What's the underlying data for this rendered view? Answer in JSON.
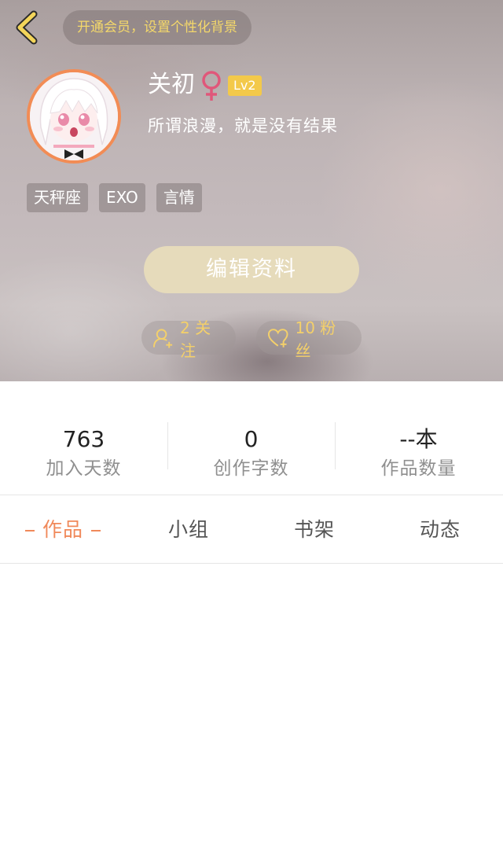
{
  "header": {
    "vip_banner": "开通会员，设置个性化背景",
    "username": "关初",
    "level": "Lv2",
    "signature": "所谓浪漫，就是没有结果",
    "tags": [
      "天秤座",
      "EXO",
      "言情"
    ],
    "edit_button": "编辑资料",
    "follow_text": "2 关注",
    "fans_text": "10 粉丝"
  },
  "stats": [
    {
      "value": "763",
      "label": "加入天数"
    },
    {
      "value": "0",
      "label": "创作字数"
    },
    {
      "value": "--本",
      "label": "作品数量"
    }
  ],
  "tabs": [
    {
      "label": "作品",
      "active": true
    },
    {
      "label": "小组",
      "active": false
    },
    {
      "label": "书架",
      "active": false
    },
    {
      "label": "动态",
      "active": false
    }
  ],
  "colors": {
    "accent": "#f0895a",
    "vip_text": "#f4d86a",
    "level_badge": "#f3c94a",
    "gender_female": "#e0577a",
    "edit_button_bg": "#e6dbbb"
  },
  "icons": {
    "back": "chevron-left-icon",
    "gender": "female-icon",
    "follow": "add-user-icon",
    "fans": "heart-plus-icon"
  }
}
